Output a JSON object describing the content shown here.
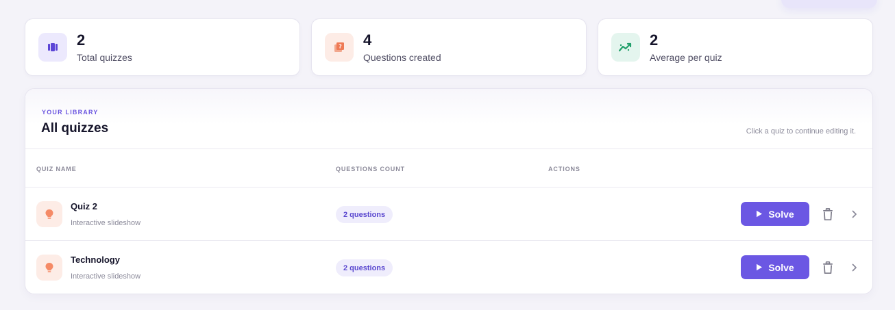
{
  "stats": [
    {
      "value": "2",
      "label": "Total quizzes",
      "icon": "layers-icon",
      "color": "#5b45d6"
    },
    {
      "value": "4",
      "label": "Questions created",
      "icon": "question-book-icon",
      "color": "#ef7a55"
    },
    {
      "value": "2",
      "label": "Average per quiz",
      "icon": "trend-icon",
      "color": "#22a06b"
    }
  ],
  "library": {
    "eyebrow": "YOUR LIBRARY",
    "title": "All quizzes",
    "hint": "Click a quiz to continue editing it."
  },
  "table": {
    "columns": [
      "QUIZ NAME",
      "QUESTIONS COUNT",
      "ACTIONS"
    ],
    "rows": [
      {
        "name": "Quiz 2",
        "subtitle": "Interactive slideshow",
        "count": "2 questions",
        "action": "Solve"
      },
      {
        "name": "Technology",
        "subtitle": "Interactive slideshow",
        "count": "2 questions",
        "action": "Solve"
      }
    ]
  },
  "colors": {
    "accent": "#6b57e3",
    "background": "#f4f3f9",
    "pill_bg": "#efedfc",
    "quiz_icon_bg": "#fdece6"
  }
}
